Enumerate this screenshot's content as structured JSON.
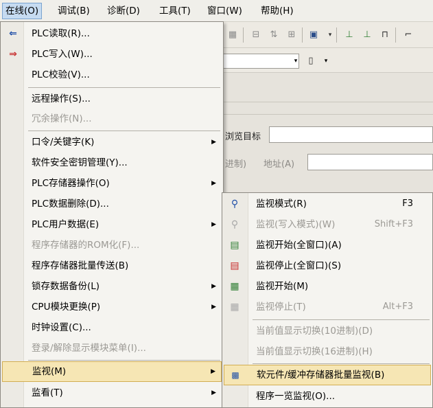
{
  "menubar": {
    "items": [
      {
        "label": "在线(O)",
        "active": true
      },
      {
        "label": "调试(B)"
      },
      {
        "label": "诊断(D)"
      },
      {
        "label": "工具(T)"
      },
      {
        "label": "窗口(W)"
      },
      {
        "label": "帮助(H)"
      }
    ]
  },
  "background": {
    "label_browse_target": "浏览目标",
    "label_decimal_fragment": "进制)",
    "label_address": "地址(A)"
  },
  "main_menu": {
    "items": [
      {
        "label": "PLC读取(R)...",
        "icon": "plc-read-icon"
      },
      {
        "label": "PLC写入(W)...",
        "icon": "plc-write-icon"
      },
      {
        "label": "PLC校验(V)..."
      },
      {
        "label": "远程操作(S)..."
      },
      {
        "label": "冗余操作(N)...",
        "disabled": true
      },
      {
        "label": "口令/关键字(K)",
        "submenu": true
      },
      {
        "label": "软件安全密钥管理(Y)..."
      },
      {
        "label": "PLC存储器操作(O)",
        "submenu": true
      },
      {
        "label": "PLC数据删除(D)..."
      },
      {
        "label": "PLC用户数据(E)",
        "submenu": true
      },
      {
        "label": "程序存储器的ROM化(F)...",
        "disabled": true
      },
      {
        "label": "程序存储器批量传送(B)"
      },
      {
        "label": "锁存数据备份(L)",
        "submenu": true
      },
      {
        "label": "CPU模块更换(P)",
        "submenu": true
      },
      {
        "label": "时钟设置(C)..."
      },
      {
        "label": "登录/解除显示模块菜单(I)...",
        "disabled": true
      },
      {
        "label": "监视(M)",
        "submenu": true,
        "highlight": true
      },
      {
        "label": "监看(T)",
        "submenu": true
      }
    ]
  },
  "sub_menu": {
    "items": [
      {
        "label": "监视模式(R)",
        "shortcut": "F3",
        "icon": "monitor-mode-icon"
      },
      {
        "label": "监视(写入模式)(W)",
        "shortcut": "Shift+F3",
        "disabled": true,
        "icon": "monitor-write-mode-icon"
      },
      {
        "label": "监视开始(全窗口)(A)",
        "icon": "monitor-start-all-icon"
      },
      {
        "label": "监视停止(全窗口)(S)",
        "icon": "monitor-stop-all-icon"
      },
      {
        "label": "监视开始(M)",
        "icon": "monitor-start-icon"
      },
      {
        "label": "监视停止(T)",
        "shortcut": "Alt+F3",
        "disabled": true,
        "icon": "monitor-stop-icon"
      },
      {
        "label": "当前值显示切换(10进制)(D)",
        "disabled": true
      },
      {
        "label": "当前值显示切换(16进制)(H)",
        "disabled": true
      },
      {
        "label": "软元件/缓冲存储器批量监视(B)",
        "highlight": true,
        "icon": "device-batch-monitor-icon"
      },
      {
        "label": "程序一览监视(O)..."
      }
    ]
  },
  "colors": {
    "highlight_bg": "#f6e6b4",
    "highlight_border": "#d2ad52",
    "disabled_text": "#9b9994",
    "menubar_active": "#c6dbf1"
  }
}
